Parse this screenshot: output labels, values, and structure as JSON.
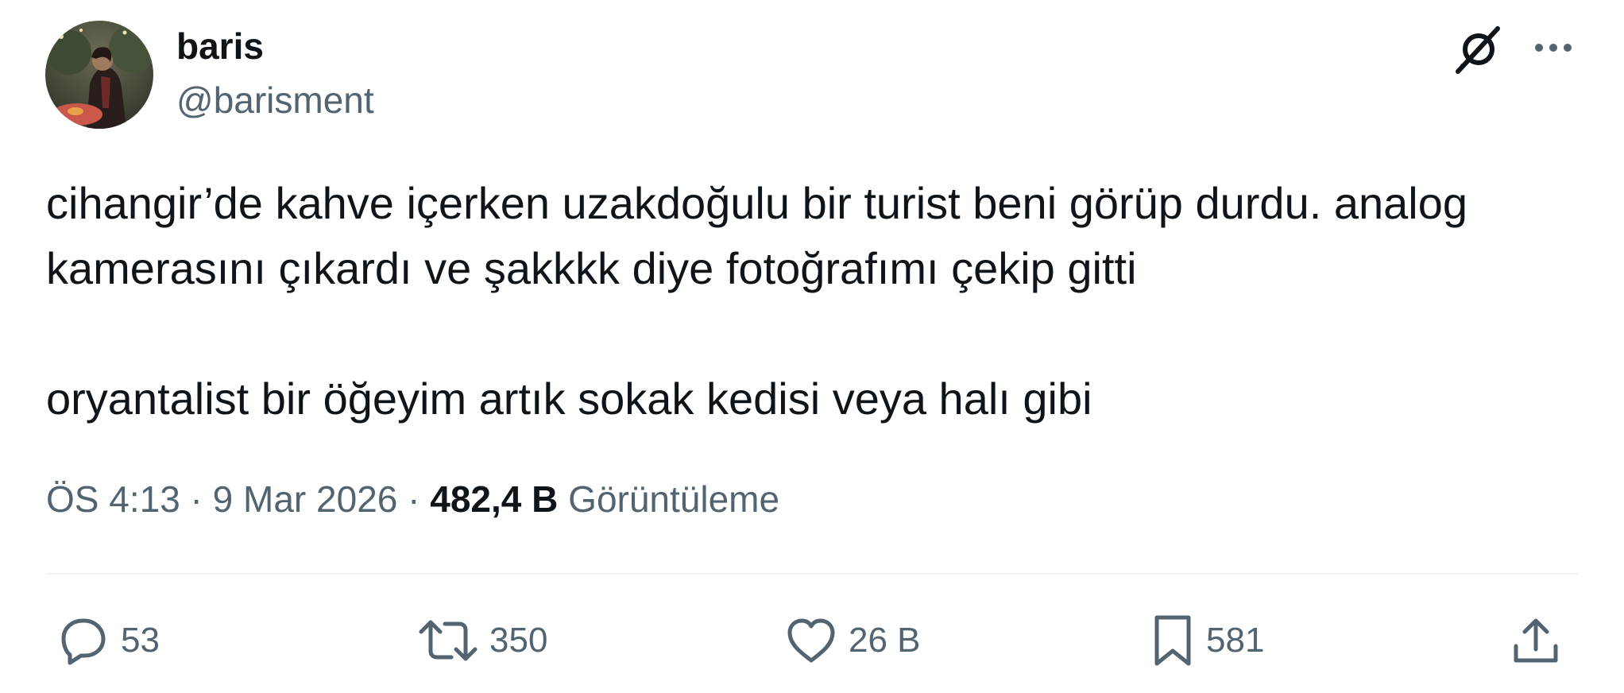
{
  "author": {
    "display_name": "baris",
    "handle": "@barisment"
  },
  "tweet": {
    "paragraph_1": "cihangir’de kahve içerken uzakdoğulu bir turist beni görüp durdu. analog kamerasını çıkardı ve şakkkk diye fotoğrafımı çekip gitti",
    "paragraph_2": "oryantalist bir öğeyim artık sokak kedisi veya halı gibi"
  },
  "meta": {
    "time": "ÖS 4:13",
    "separator_1": " · ",
    "date": "9 Mar 2026",
    "separator_2": " · ",
    "views_count": "482,4 B",
    "views_label": " Görüntüleme"
  },
  "actions": {
    "reply_count": "53",
    "retweet_count": "350",
    "like_count": "26 B",
    "bookmark_count": "581"
  },
  "icons": {
    "header": [
      "grok-icon",
      "more-icon"
    ],
    "actions": [
      "reply-icon",
      "retweet-icon",
      "like-icon",
      "bookmark-icon",
      "share-icon"
    ]
  },
  "colors": {
    "text_primary": "#0f1419",
    "text_secondary": "#536471",
    "divider": "#eff3f4"
  }
}
